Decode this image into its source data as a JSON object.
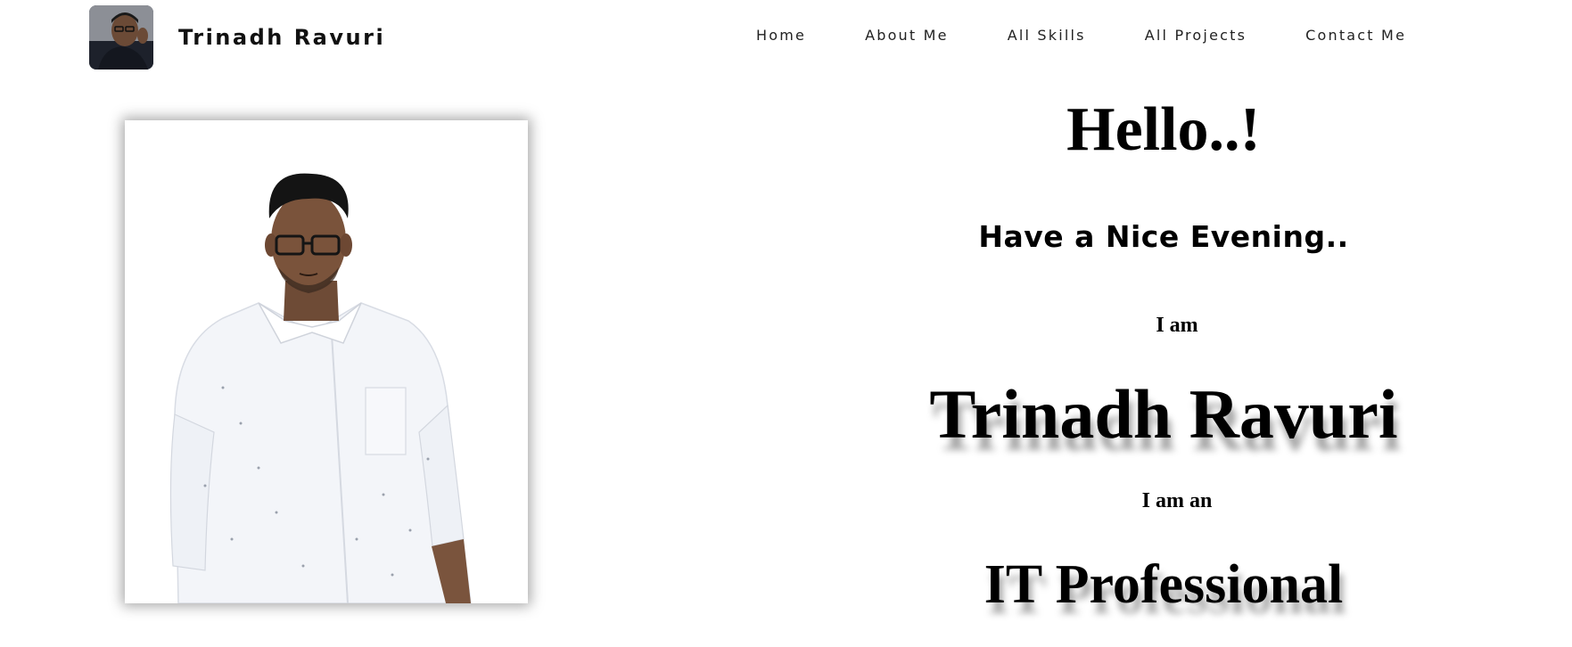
{
  "header": {
    "brand_name": "Trinadh Ravuri",
    "avatar_icon": "profile-photo-icon",
    "nav": [
      {
        "label": "Home"
      },
      {
        "label": "About Me"
      },
      {
        "label": "All Skills"
      },
      {
        "label": "All Projects"
      },
      {
        "label": "Contact Me"
      }
    ]
  },
  "hero": {
    "photo_icon": "portrait-photo-icon",
    "hello": "Hello..!",
    "greeting": "Have a Nice Evening..",
    "i_am": "I am",
    "name": "Trinadh Ravuri",
    "i_am_an": "I am an",
    "profession": "IT Professional"
  },
  "colors": {
    "background": "#ffffff",
    "text": "#000000",
    "shirt": "#f4f6fa",
    "avatar_bg": "#2e3340"
  }
}
